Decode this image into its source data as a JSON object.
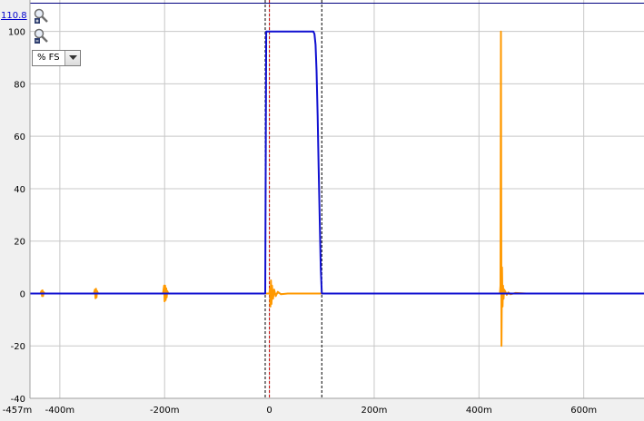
{
  "toolbar": {
    "ymax_value": "110.8",
    "unit_option": "% FS"
  },
  "icons": {
    "zoom_in": "zoom-in-icon",
    "zoom_out": "zoom-out-icon",
    "dropdown": "chevron-down-icon"
  },
  "colors": {
    "series_blue": "#1010d0",
    "series_orange": "#ff9900",
    "marker_red": "#cc0000",
    "limit_line": "#000080",
    "grid": "#c8c8c8",
    "plot_bg": "#ffffff"
  },
  "chart_data": {
    "type": "line",
    "xlim": [
      -457,
      715
    ],
    "ylim": [
      -40,
      112
    ],
    "ymax_line": 110.8,
    "x_ticks": [
      {
        "value": -457,
        "label": "-457m"
      },
      {
        "value": -400,
        "label": "-400m"
      },
      {
        "value": -200,
        "label": "-200m"
      },
      {
        "value": 0,
        "label": "0"
      },
      {
        "value": 200,
        "label": "200m"
      },
      {
        "value": 400,
        "label": "400m"
      },
      {
        "value": 600,
        "label": "600m"
      }
    ],
    "y_ticks": [
      {
        "value": 100,
        "label": "100"
      },
      {
        "value": 80,
        "label": "80"
      },
      {
        "value": 60,
        "label": "60"
      },
      {
        "value": 40,
        "label": "40"
      },
      {
        "value": 20,
        "label": "20"
      },
      {
        "value": 0,
        "label": "0"
      },
      {
        "value": -20,
        "label": "-20"
      },
      {
        "value": -40,
        "label": "-40"
      }
    ],
    "markers": [
      {
        "x": -8,
        "style": "dashed",
        "color": "#000000"
      },
      {
        "x": 0,
        "style": "dashed",
        "color": "#cc0000"
      },
      {
        "x": 100,
        "style": "dashed",
        "color": "#000000"
      }
    ],
    "series": [
      {
        "color": "#ff9900",
        "x": [
          -457,
          -437,
          -435,
          -434,
          -433,
          -432,
          -431,
          -429,
          -335,
          -333,
          -332,
          -331,
          -330,
          -329,
          -327,
          -203,
          -201,
          -200,
          -199,
          -198,
          -197,
          -196,
          -195,
          -193,
          0,
          1,
          2,
          3,
          4,
          5,
          7,
          9,
          12,
          16,
          22,
          35,
          100,
          440,
          441,
          442,
          443,
          444,
          445,
          446,
          447,
          448,
          450,
          453,
          456,
          460,
          470,
          490,
          715
        ],
        "y": [
          0,
          0,
          1,
          -1,
          1.2,
          -1,
          0.5,
          0,
          0,
          1.5,
          -1.8,
          1.8,
          -1.5,
          1,
          0,
          0,
          3,
          -3,
          3,
          -2.5,
          2,
          -1.5,
          1,
          0,
          0,
          2,
          -5,
          5,
          -4,
          3,
          -2,
          1.5,
          -1,
          0.6,
          -0.3,
          0,
          0,
          0,
          3,
          100,
          -20,
          10,
          -5,
          3,
          -2,
          1.5,
          0.8,
          -0.5,
          0.4,
          -0.3,
          0.2,
          0,
          0
        ]
      },
      {
        "color": "#1010d0",
        "x": [
          -457,
          -8,
          -6,
          0,
          84,
          86,
          88,
          90,
          92,
          94,
          96,
          98,
          100,
          715
        ],
        "y": [
          0,
          0,
          100,
          100,
          100,
          99,
          95,
          85,
          68,
          48,
          28,
          10,
          0,
          0
        ]
      }
    ]
  }
}
